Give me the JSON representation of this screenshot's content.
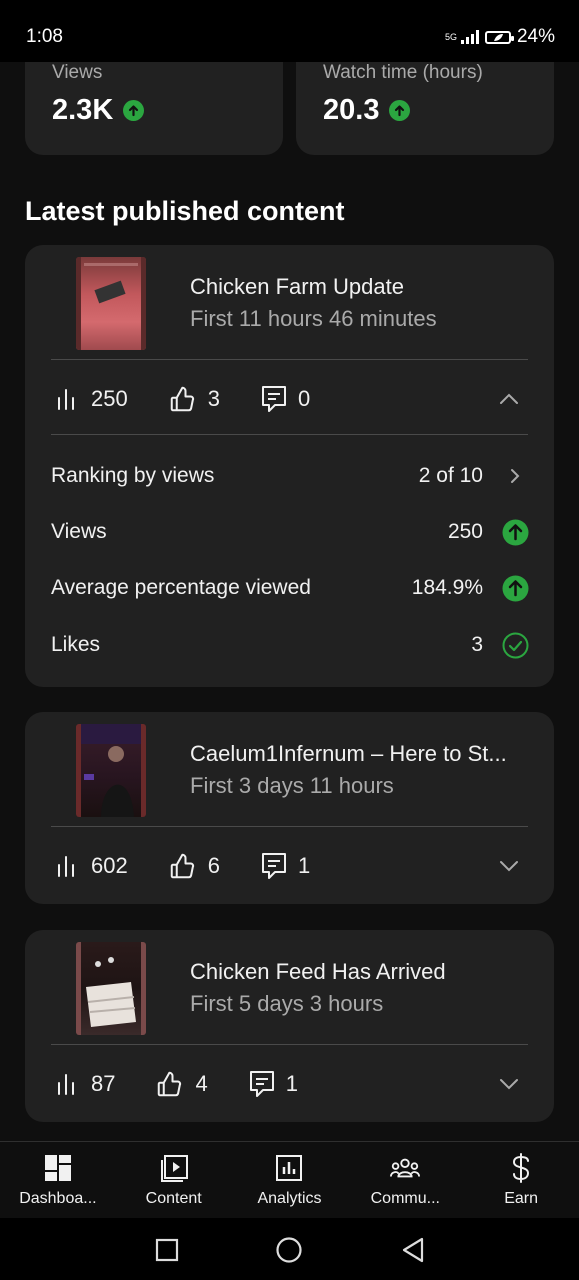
{
  "status_bar": {
    "time": "1:08",
    "network": "5G",
    "battery": "24%"
  },
  "stats": [
    {
      "label": "Views",
      "value": "2.3K"
    },
    {
      "label": "Watch time (hours)",
      "value": "20.3"
    }
  ],
  "section_title": "Latest published content",
  "videos": [
    {
      "title": "Chicken Farm Update",
      "subtitle": "First 11 hours 46 minutes",
      "views": "250",
      "likes": "3",
      "comments": "0",
      "expanded": true,
      "details": [
        {
          "label": "Ranking by views",
          "value": "2 of 10",
          "icon": "chevron-right-icon"
        },
        {
          "label": "Views",
          "value": "250",
          "icon": "trend-up-icon"
        },
        {
          "label": "Average percentage viewed",
          "value": "184.9%",
          "icon": "trend-up-icon"
        },
        {
          "label": "Likes",
          "value": "3",
          "icon": "check-circle-icon"
        }
      ]
    },
    {
      "title": "Caelum1Infernum – Here to St...",
      "subtitle": "First 3 days 11 hours",
      "views": "602",
      "likes": "6",
      "comments": "1",
      "expanded": false
    },
    {
      "title": "Chicken Feed Has Arrived",
      "subtitle": "First 5 days 3 hours",
      "views": "87",
      "likes": "4",
      "comments": "1",
      "expanded": false
    }
  ],
  "bottom_nav": [
    {
      "label": "Dashboa...",
      "icon": "dashboard-icon"
    },
    {
      "label": "Content",
      "icon": "content-icon"
    },
    {
      "label": "Analytics",
      "icon": "analytics-icon"
    },
    {
      "label": "Commu...",
      "icon": "community-icon"
    },
    {
      "label": "Earn",
      "icon": "dollar-icon"
    }
  ],
  "colors": {
    "background": "#0f0f0f",
    "card": "#212121",
    "accent_green": "#2ba640",
    "muted_text": "#aaaaaa"
  }
}
